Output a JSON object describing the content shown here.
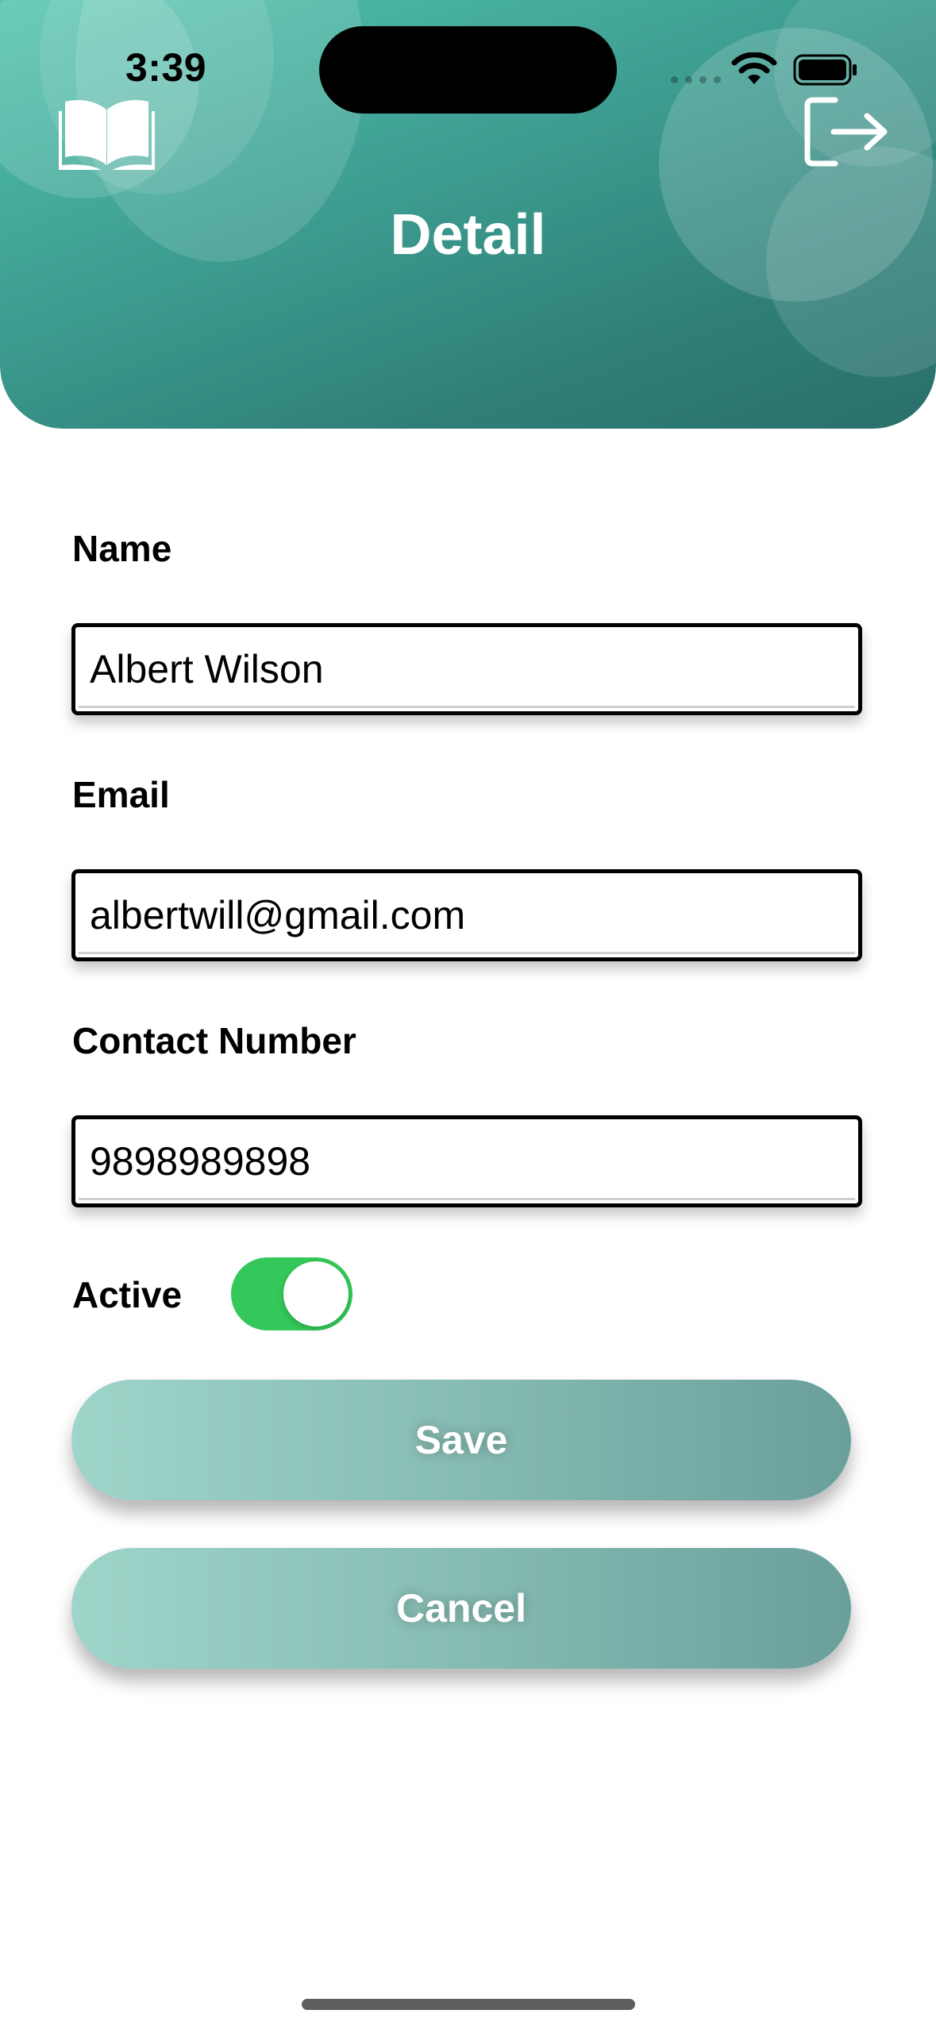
{
  "status_bar": {
    "time": "3:39"
  },
  "header": {
    "title": "Detail",
    "left_icon": "book-icon",
    "right_icon": "logout-icon"
  },
  "form": {
    "name": {
      "label": "Name",
      "value": "Albert Wilson"
    },
    "email": {
      "label": "Email",
      "value": "albertwill@gmail.com"
    },
    "contact": {
      "label": "Contact Number",
      "value": "9898989898"
    },
    "active": {
      "label": "Active",
      "checked": true
    }
  },
  "buttons": {
    "save_label": "Save",
    "cancel_label": "Cancel"
  },
  "colors": {
    "header_gradient_start": "#52c4ad",
    "header_gradient_end": "#2a6f6c",
    "toggle_on": "#34c759",
    "button_gradient_start": "#9fd4c9",
    "button_gradient_end": "#6a9f9c"
  }
}
